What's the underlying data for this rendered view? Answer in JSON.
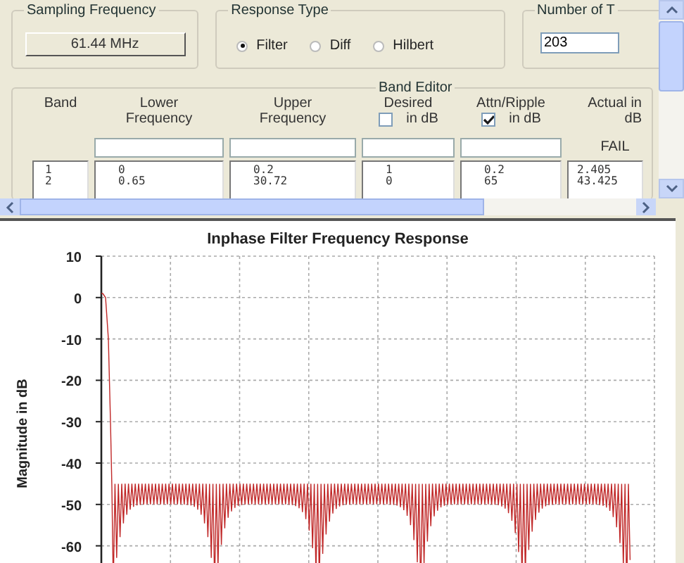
{
  "sampling_frequency": {
    "label": "Sampling Frequency",
    "value": "61.44 MHz"
  },
  "response_type": {
    "label": "Response Type",
    "options": [
      {
        "label": "Filter",
        "selected": true
      },
      {
        "label": "Diff",
        "selected": false
      },
      {
        "label": "Hilbert",
        "selected": false
      }
    ]
  },
  "number_of_taps": {
    "label": "Number of T",
    "value": "203"
  },
  "band_editor": {
    "title": "Band Editor",
    "columns": [
      {
        "kind": "plain",
        "heading": "Band",
        "lines": [
          "1",
          "2"
        ]
      },
      {
        "kind": "input",
        "heading": "Lower Frequency",
        "lines": [
          "0",
          "0.65"
        ]
      },
      {
        "kind": "input",
        "heading": "Upper Frequency",
        "lines": [
          "0.2",
          "30.72"
        ]
      },
      {
        "kind": "check",
        "heading": "Desired",
        "unit": "in dB",
        "checked": false,
        "lines": [
          "1",
          "0"
        ]
      },
      {
        "kind": "check",
        "heading": "Attn/Ripple",
        "unit": "in dB",
        "checked": true,
        "lines": [
          "0.2",
          "65"
        ]
      },
      {
        "kind": "status",
        "heading": "Actual in dB",
        "status": "FAIL",
        "lines": [
          "2.405",
          "43.425"
        ]
      }
    ]
  },
  "plot": {
    "title": "Inphase Filter Frequency Response",
    "ylabel": "Magnitude in dB",
    "ytick_labels": [
      "10",
      "0",
      "-10",
      "-20",
      "-30",
      "-40",
      "-50",
      "-60"
    ]
  }
}
